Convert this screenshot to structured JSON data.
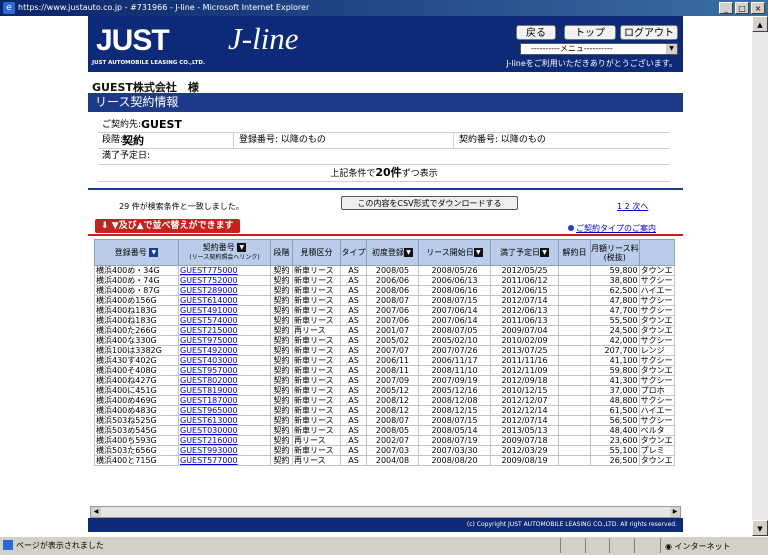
{
  "window": {
    "title": "https://www.justauto.co.jp - #731966 - J-line - Microsoft Internet Explorer",
    "controls": [
      "_",
      "□",
      "×"
    ]
  },
  "header": {
    "logo": "JUST",
    "logo_sub": "JUST AUTOMOBILE LEASING CO.,LTD.",
    "brand": "J-line",
    "nav": {
      "back": "戻る",
      "top": "トップ",
      "logout": "ログアウト"
    },
    "menu_selected": "----------メニュ----------",
    "welcome": "J-lineをご利用いただきありがとうございます。"
  },
  "company": "GUEST株式会社　様",
  "section_title": "リース契約情報",
  "criteria": {
    "client_label": "ご契約先:",
    "client_value": "GUEST",
    "stage_label": "段階:",
    "stage_value": "契約",
    "reg_label": "登録番号: 以降のもの",
    "contract_label": "契約番号: 以降のもの",
    "expiry_label": "満了予定日:",
    "display_prefix": "上記条件で",
    "display_count": "20件",
    "display_suffix": "ずつ表示"
  },
  "results": {
    "count_text": "29 件が検索条件と一致しました。",
    "csv_button": "この内容をCSV形式でダウンロードする",
    "page_links": "1 2 次へ",
    "sort_banner": "▼及び▲で並べ替えができます",
    "contract_type_link": "ご契約タイプのご案内"
  },
  "table": {
    "headers": {
      "reg_no": "登録番号",
      "contract_no": "契約番号",
      "contract_no_sub": "(リース契約照会へリンク)",
      "stage": "段階",
      "estimate_type": "見積区分",
      "type": "タイプ",
      "first_reg": "初度登録",
      "lease_start": "リース開始日",
      "expiry": "満了予定日",
      "termination": "解約日",
      "monthly_fee": "月額リース料",
      "monthly_fee_sub": "(税抜)"
    },
    "rows": [
      [
        "横浜400め・34G",
        "GUEST775000",
        "契約",
        "新車リース",
        "AS",
        "2008/05",
        "2008/05/26",
        "2012/05/25",
        "",
        "59,800",
        "タウンエ"
      ],
      [
        "横浜400め・74G",
        "GUEST752000",
        "契約",
        "新車リース",
        "AS",
        "2006/06",
        "2006/06/13",
        "2011/06/12",
        "",
        "38,800",
        "サクシー"
      ],
      [
        "横浜400め・87G",
        "GUEST289000",
        "契約",
        "新車リース",
        "AS",
        "2008/06",
        "2008/06/16",
        "2012/06/15",
        "",
        "62,500",
        "ハイエー"
      ],
      [
        "横浜400め156G",
        "GUEST614000",
        "契約",
        "新車リース",
        "AS",
        "2008/07",
        "2008/07/15",
        "2012/07/14",
        "",
        "47,800",
        "サクシー"
      ],
      [
        "横浜400ね183G",
        "GUEST491000",
        "契約",
        "新車リース",
        "AS",
        "2007/06",
        "2007/06/14",
        "2012/06/13",
        "",
        "47,700",
        "サクシー"
      ],
      [
        "横浜400ね183G",
        "GUEST574000",
        "契約",
        "新車リース",
        "AS",
        "2007/06",
        "2007/06/14",
        "2011/06/13",
        "",
        "55,500",
        "タウンエ"
      ],
      [
        "横浜400た266G",
        "GUEST215000",
        "契約",
        "再リース",
        "AS",
        "2001/07",
        "2008/07/05",
        "2009/07/04",
        "",
        "24,500",
        "タウンエ"
      ],
      [
        "横浜400な330G",
        "GUEST975000",
        "契約",
        "新車リース",
        "AS",
        "2005/02",
        "2005/02/10",
        "2010/02/09",
        "",
        "42,000",
        "サクシー"
      ],
      [
        "横浜100は3382G",
        "GUEST492000",
        "契約",
        "新車リース",
        "AS",
        "2007/07",
        "2007/07/26",
        "2013/07/25",
        "",
        "207,700",
        "レンジ"
      ],
      [
        "横浜430す402G",
        "GUEST403000",
        "契約",
        "新車リース",
        "AS",
        "2006/11",
        "2006/11/17",
        "2011/11/16",
        "",
        "41,100",
        "サクシー"
      ],
      [
        "横浜400そ408G",
        "GUEST957000",
        "契約",
        "新車リース",
        "AS",
        "2008/11",
        "2008/11/10",
        "2012/11/09",
        "",
        "59,800",
        "タウンエ"
      ],
      [
        "横浜400ね427G",
        "GUEST802000",
        "契約",
        "新車リース",
        "AS",
        "2007/09",
        "2007/09/19",
        "2012/09/18",
        "",
        "41,300",
        "サクシー"
      ],
      [
        "横浜400に451G",
        "GUEST819000",
        "契約",
        "新車リース",
        "AS",
        "2005/12",
        "2005/12/16",
        "2010/12/15",
        "",
        "37,000",
        "プロホ"
      ],
      [
        "横浜400め469G",
        "GUEST187000",
        "契約",
        "新車リース",
        "AS",
        "2008/12",
        "2008/12/08",
        "2012/12/07",
        "",
        "48,800",
        "サクシー"
      ],
      [
        "横浜400め483G",
        "GUEST965000",
        "契約",
        "新車リース",
        "AS",
        "2008/12",
        "2008/12/15",
        "2012/12/14",
        "",
        "61,500",
        "ハイエー"
      ],
      [
        "横浜503ね525G",
        "GUEST613000",
        "契約",
        "新車リース",
        "AS",
        "2008/07",
        "2008/07/15",
        "2012/07/14",
        "",
        "56,500",
        "サクシー"
      ],
      [
        "横浜503め545G",
        "GUEST030000",
        "契約",
        "新車リース",
        "AS",
        "2008/05",
        "2008/05/14",
        "2013/05/13",
        "",
        "48,400",
        "ベルタ"
      ],
      [
        "横浜400ち593G",
        "GUEST216000",
        "契約",
        "再リース",
        "AS",
        "2002/07",
        "2008/07/19",
        "2009/07/18",
        "",
        "23,600",
        "タウンエ"
      ],
      [
        "横浜503た656G",
        "GUEST993000",
        "契約",
        "新車リース",
        "AS",
        "2007/03",
        "2007/03/30",
        "2012/03/29",
        "",
        "55,100",
        "プレミ"
      ],
      [
        "横浜400と715G",
        "GUEST577000",
        "契約",
        "再リース",
        "AS",
        "2004/08",
        "2008/08/20",
        "2009/08/19",
        "",
        "26,500",
        "タウンエ"
      ]
    ]
  },
  "footer": "(c) Copyright  JUST AUTOMOBILE LEASING CO.,LTD. All rights reserved.",
  "statusbar": {
    "status": "ページが表示されました",
    "zone": "インターネット"
  }
}
